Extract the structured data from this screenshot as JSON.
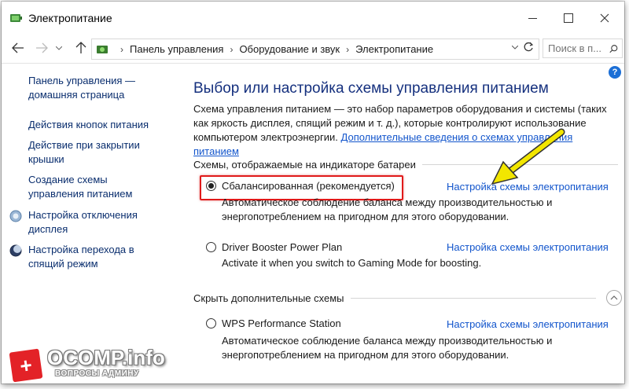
{
  "window": {
    "title": "Электропитание",
    "icon": "power-options-icon"
  },
  "addressbar": {
    "crumbs": [
      "Панель управления",
      "Оборудование и звук",
      "Электропитание"
    ],
    "search_placeholder": "Поиск в п..."
  },
  "help_label": "?",
  "sidebar": {
    "items": [
      {
        "label": "Панель управления — домашняя страница"
      },
      {
        "label": "Действия кнопок питания"
      },
      {
        "label": "Действие при закрытии крышки"
      },
      {
        "label": "Создание схемы управления питанием"
      },
      {
        "label": "Настройка отключения дисплея",
        "icon": "display-icon"
      },
      {
        "label": "Настройка перехода в спящий режим",
        "icon": "sleep-moon-icon"
      }
    ]
  },
  "main": {
    "title": "Выбор или настройка схемы управления питанием",
    "description": "Схема управления питанием — это набор параметров оборудования и системы (таких как яркость дисплея, спящий режим и т. д.), которые контролируют использование компьютером электроэнергии.",
    "more_link": "Дополнительные сведения о схемах управления питанием",
    "section_battery": "Схемы, отображаемые на индикаторе батареи",
    "section_hidden": "Скрыть дополнительные схемы",
    "plans": [
      {
        "name": "Сбалансированная (рекомендуется)",
        "selected": true,
        "link": "Настройка схемы электропитания",
        "desc": "Автоматическое соблюдение баланса между производительностью и энергопотреблением на пригодном для этого оборудовании."
      },
      {
        "name": "Driver Booster Power Plan",
        "selected": false,
        "link": "Настройка схемы электропитания",
        "desc": "Activate it when you switch to Gaming Mode for boosting."
      },
      {
        "name": "WPS Performance Station",
        "selected": false,
        "link": "Настройка схемы электропитания",
        "desc": "Автоматическое соблюдение баланса между производительностью и энергопотреблением на пригодном для этого оборудовании."
      }
    ]
  },
  "watermark": {
    "title": "OCOMP.info",
    "subtitle": "ВОПРОСЫ АДМИНУ",
    "badge": "+"
  },
  "colors": {
    "link": "#1255cc",
    "title": "#15307e",
    "nav_link": "#0a2e6e",
    "highlight": "#e01a1a",
    "arrow": "#f2e600"
  }
}
